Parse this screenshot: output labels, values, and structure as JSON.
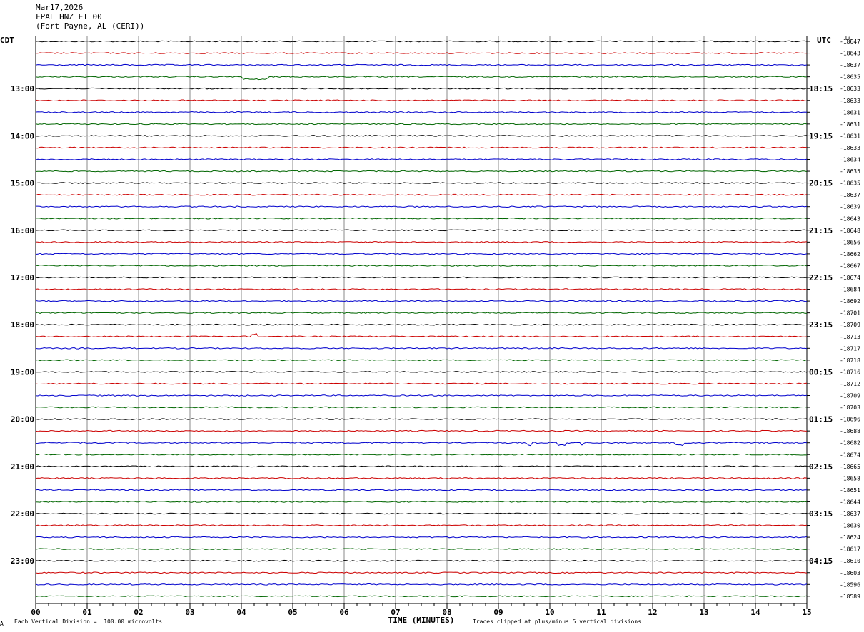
{
  "header": {
    "date": "Mar17,2026",
    "station": "FPAL HNZ ET 00",
    "location": "(Fort Payne, AL (CERI))"
  },
  "left_axis_label": "CDT",
  "right_axis_label": "UTC",
  "dc_label": "DC",
  "footer": {
    "scale_note": "Each Vertical Division =  100.00 microvolts",
    "clip_note": "Traces clipped at plus/minus 5 vertical divisions",
    "corner_mark": "A"
  },
  "colors": {
    "trace_cycle": [
      "#000000",
      "#cc0000",
      "#0000cc",
      "#006600"
    ],
    "grid": "#888888"
  },
  "chart_data": {
    "type": "line",
    "title": "FPAL HNZ ET 00",
    "xlabel": "TIME (MINUTES)",
    "ylabel": "",
    "xlim": [
      0,
      15
    ],
    "x_ticks": [
      "00",
      "01",
      "02",
      "03",
      "04",
      "05",
      "06",
      "07",
      "08",
      "09",
      "10",
      "11",
      "12",
      "13",
      "14",
      "15"
    ],
    "local_hour_labels": [
      "13:00",
      "14:00",
      "15:00",
      "16:00",
      "17:00",
      "18:00",
      "19:00",
      "20:00",
      "21:00",
      "22:00",
      "23:00"
    ],
    "utc_hour_labels": [
      "18:15",
      "19:15",
      "20:15",
      "21:15",
      "22:15",
      "23:15",
      "00:15",
      "01:15",
      "02:15",
      "03:15",
      "04:15"
    ],
    "dc_offsets": [
      "-18647",
      "-18643",
      "-18637",
      "-18635",
      "-18633",
      "-18633",
      "-18631",
      "-18631",
      "-18631",
      "-18633",
      "-18634",
      "-18635",
      "-18635",
      "-18637",
      "-18639",
      "-18643",
      "-18648",
      "-18656",
      "-18662",
      "-18667",
      "-18674",
      "-18684",
      "-18692",
      "-18701",
      "-18709",
      "-18713",
      "-18717",
      "-18718",
      "-18716",
      "-18712",
      "-18709",
      "-18703",
      "-18696",
      "-18688",
      "-18682",
      "-18674",
      "-18665",
      "-18658",
      "-18651",
      "-18644",
      "-18637",
      "-18630",
      "-18624",
      "-18617",
      "-18610",
      "-18603",
      "-18596",
      "-18589"
    ],
    "trace_count": 48,
    "first_trace_quarter": 1,
    "events": [
      {
        "trace": 3,
        "x_min": 4.03,
        "x_end": 4.5,
        "amplitude_div": -1.0,
        "kind": "step"
      },
      {
        "trace": 25,
        "x_min": 4.2,
        "x_end": 4.3,
        "amplitude_div": 1.0,
        "kind": "spike"
      },
      {
        "trace": 34,
        "x_min": 9.55,
        "x_end": 9.65,
        "amplitude_div": -1.0,
        "kind": "spike"
      },
      {
        "trace": 34,
        "x_min": 10.15,
        "x_end": 10.3,
        "amplitude_div": -1.0,
        "kind": "spike"
      },
      {
        "trace": 34,
        "x_min": 10.6,
        "x_end": 10.65,
        "amplitude_div": -1.0,
        "kind": "spike"
      },
      {
        "trace": 34,
        "x_min": 12.45,
        "x_end": 12.6,
        "amplitude_div": -1.0,
        "kind": "spike"
      }
    ]
  }
}
